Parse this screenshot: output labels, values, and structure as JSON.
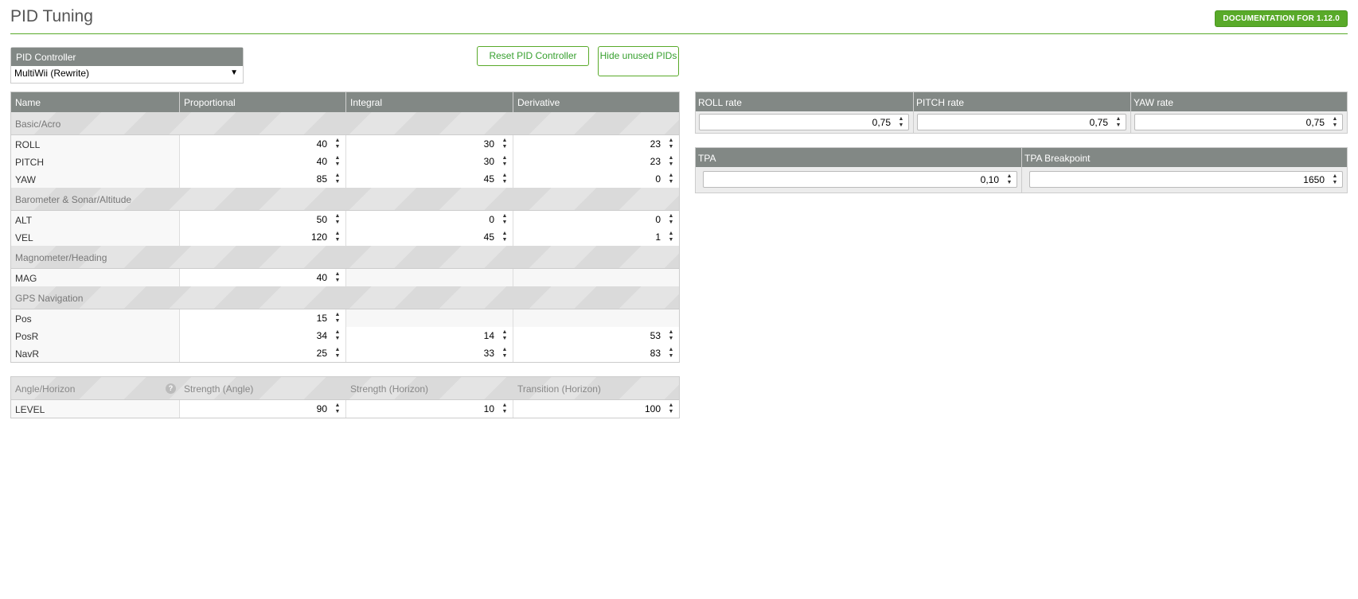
{
  "header": {
    "title": "PID Tuning",
    "doc_button": "DOCUMENTATION FOR 1.12.0"
  },
  "controller": {
    "label": "PID Controller",
    "selected": "MultiWii (Rewrite)"
  },
  "buttons": {
    "reset": "Reset PID Controller",
    "hide": "Hide unused PIDs"
  },
  "pid_table": {
    "columns": [
      "Name",
      "Proportional",
      "Integral",
      "Derivative"
    ],
    "sections": [
      {
        "title": "Basic/Acro",
        "rows": [
          {
            "name": "ROLL",
            "p": "40",
            "i": "30",
            "d": "23"
          },
          {
            "name": "PITCH",
            "p": "40",
            "i": "30",
            "d": "23"
          },
          {
            "name": "YAW",
            "p": "85",
            "i": "45",
            "d": "0"
          }
        ]
      },
      {
        "title": "Barometer & Sonar/Altitude",
        "rows": [
          {
            "name": "ALT",
            "p": "50",
            "i": "0",
            "d": "0"
          },
          {
            "name": "VEL",
            "p": "120",
            "i": "45",
            "d": "1"
          }
        ]
      },
      {
        "title": "Magnometer/Heading",
        "rows": [
          {
            "name": "MAG",
            "p": "40",
            "i": "",
            "d": ""
          }
        ]
      },
      {
        "title": "GPS Navigation",
        "rows": [
          {
            "name": "Pos",
            "p": "15",
            "i": "",
            "d": ""
          },
          {
            "name": "PosR",
            "p": "34",
            "i": "14",
            "d": "53"
          },
          {
            "name": "NavR",
            "p": "25",
            "i": "33",
            "d": "83"
          }
        ]
      }
    ]
  },
  "level_table": {
    "columns": [
      "Angle/Horizon",
      "Strength (Angle)",
      "Strength (Horizon)",
      "Transition (Horizon)"
    ],
    "row": {
      "name": "LEVEL",
      "strength_angle": "90",
      "strength_horizon": "10",
      "transition_horizon": "100"
    }
  },
  "rates": {
    "columns": [
      "ROLL rate",
      "PITCH rate",
      "YAW rate"
    ],
    "values": [
      "0,75",
      "0,75",
      "0,75"
    ]
  },
  "tpa": {
    "columns": [
      "TPA",
      "TPA Breakpoint"
    ],
    "values": [
      "0,10",
      "1650"
    ]
  },
  "colors": {
    "accent": "#59aa29",
    "header_bg": "#828885"
  }
}
